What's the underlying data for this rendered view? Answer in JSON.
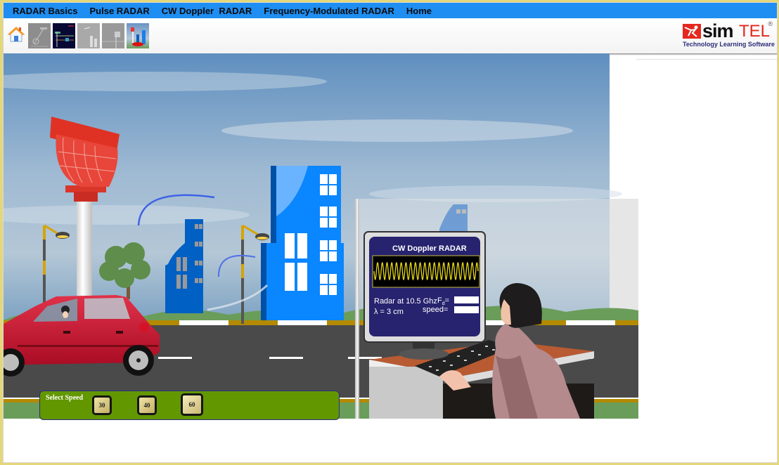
{
  "menubar": {
    "items": [
      {
        "label": "RADAR Basics"
      },
      {
        "label": "Pulse RADAR"
      },
      {
        "label": "CW Doppler  RADAR"
      },
      {
        "label": "Frequency-Modulated RADAR"
      },
      {
        "label": "Home"
      }
    ]
  },
  "toolbar": {
    "home_icon": "home-icon",
    "thumbnails": [
      {
        "name": "radar-basics-thumbnail",
        "active": false
      },
      {
        "name": "pulse-radar-thumbnail",
        "active": false
      },
      {
        "name": "radar-scene-thumbnail",
        "active": false
      },
      {
        "name": "radar-antenna-thumbnail",
        "active": false
      },
      {
        "name": "cw-doppler-thumbnail",
        "active": true
      }
    ]
  },
  "logo": {
    "brand_part1": "sim",
    "brand_part2": "TEL",
    "registered": "®",
    "tagline": "Technology Learning Software"
  },
  "monitor": {
    "title": "CW Doppler RADAR",
    "frequency_label": "Radar at 10.5 Ghz",
    "wavelength_label": "λ =  3 cm",
    "fd_label": "F",
    "fd_subscript": "d",
    "fd_eq": "=",
    "fd_value": "",
    "speed_label": "speed=",
    "speed_value": ""
  },
  "speed_panel": {
    "label": "Select Speed",
    "options": [
      {
        "label": "30",
        "selected": false
      },
      {
        "label": "40",
        "selected": false
      },
      {
        "label": "60",
        "selected": true
      }
    ]
  },
  "colors": {
    "menubar": "#1e8ef2",
    "speed_panel": "#629700",
    "monitor_screen": "#27236f",
    "wave": "#e6d81c",
    "car": "#c8102e",
    "radar": "#e03224",
    "building_dark": "#0060c4",
    "building_light": "#0a86ff"
  }
}
